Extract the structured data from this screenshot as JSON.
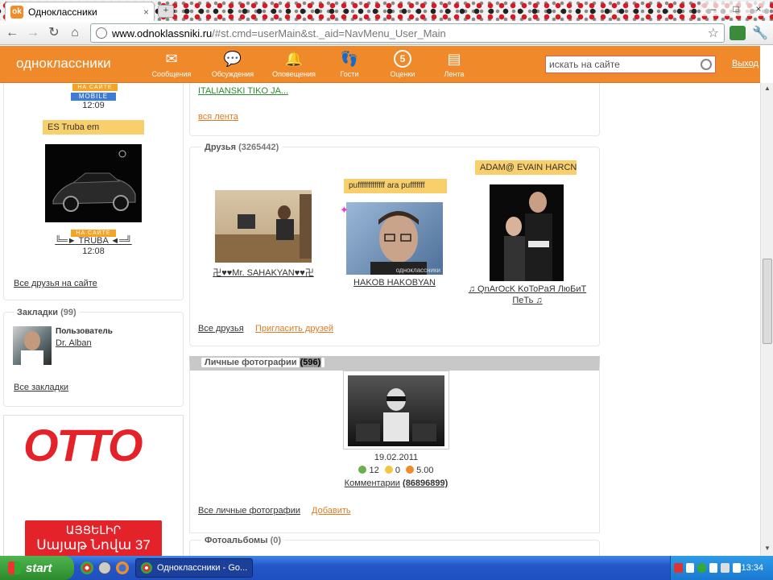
{
  "browser": {
    "tab_title": "Одноклассники",
    "tab_close": "×",
    "new_tab": "+",
    "url_host": "www.odnoklassniki.ru",
    "url_rest": "/#st.cmd=userMain&st._aid=NavMenu_User_Main",
    "window_controls": [
      "–",
      "□",
      "×"
    ]
  },
  "site": {
    "logo": "одноклассники",
    "nav": [
      {
        "label": "Сообщения",
        "icon": "envelope-icon",
        "glyph": "✉"
      },
      {
        "label": "Обсуждения",
        "icon": "chat-bubbles-icon",
        "glyph": "💬"
      },
      {
        "label": "Оповещения",
        "icon": "bell-icon",
        "glyph": "🔔"
      },
      {
        "label": "Гости",
        "icon": "footprints-icon",
        "glyph": "👣"
      },
      {
        "label": "Оценки",
        "icon": "rating-five-icon",
        "glyph": "5"
      },
      {
        "label": "Лента",
        "icon": "feed-icon",
        "glyph": "▤"
      }
    ],
    "search_placeholder": "искать на сайте",
    "logout": "Выход"
  },
  "sidebar": {
    "friend1": {
      "status": "НА САЙТЕ",
      "mobile": "MOBILE",
      "time": "12:09"
    },
    "friend2": {
      "bubble": "ES Truba em",
      "status": "НА САЙТЕ",
      "name": "╚═► TRUBA ◄═╝",
      "time": "12:08"
    },
    "all_friends_online": "Все друзья на сайте",
    "bookmarks": {
      "title": "Закладки",
      "count": "(99)",
      "item_type": "Пользователь",
      "item_name": "Dr. Alban",
      "all_link": "Все закладки"
    },
    "ad": {
      "brand": "OTTO",
      "line1": "ԱՅՑԵԼԻՐ",
      "line2": "Սայաթ Նովա 37"
    }
  },
  "feed": {
    "last_item_link": "ITALIANSKI TIKO JA...",
    "all_feed": "вся лента"
  },
  "friends": {
    "title": "Друзья",
    "count": "(3265442)",
    "items": [
      {
        "name": "卍♥♥Mr. SAHAKYAN♥♥卍",
        "bubble": ""
      },
      {
        "name": "HAKOB HAKOBYAN",
        "bubble": "pufffffffffffff ara pufffffff",
        "watermark": "одноклассники"
      },
      {
        "name_line1": "♫ QnArOcK KoToPaЯ ЛюБиТ",
        "name_line2": "ПеТь ♫",
        "bubble": "ADAM@ EVAIN HARCNI"
      }
    ],
    "all_friends": "Все друзья",
    "invite": "Пригласить друзей"
  },
  "photos": {
    "title": "Личные фотографии",
    "count": "(596)",
    "date": "19.02.2011",
    "likes": "12",
    "neutral": "0",
    "rating": "5.00",
    "comments_label": "Комментарии",
    "comments_count": "(86896899)",
    "all_photos": "Все личные фотографии",
    "add": "Добавить"
  },
  "albums": {
    "title": "Фотоальбомы",
    "count": "(0)"
  },
  "taskbar": {
    "start": "start",
    "task": "Одноклассники - Go...",
    "clock": "13:34"
  },
  "colors": {
    "brand": "#f0892a",
    "bubble": "#f9cf6b",
    "online": "#f7a325",
    "mobile": "#3e7bd6",
    "ad_red": "#e3222a"
  }
}
